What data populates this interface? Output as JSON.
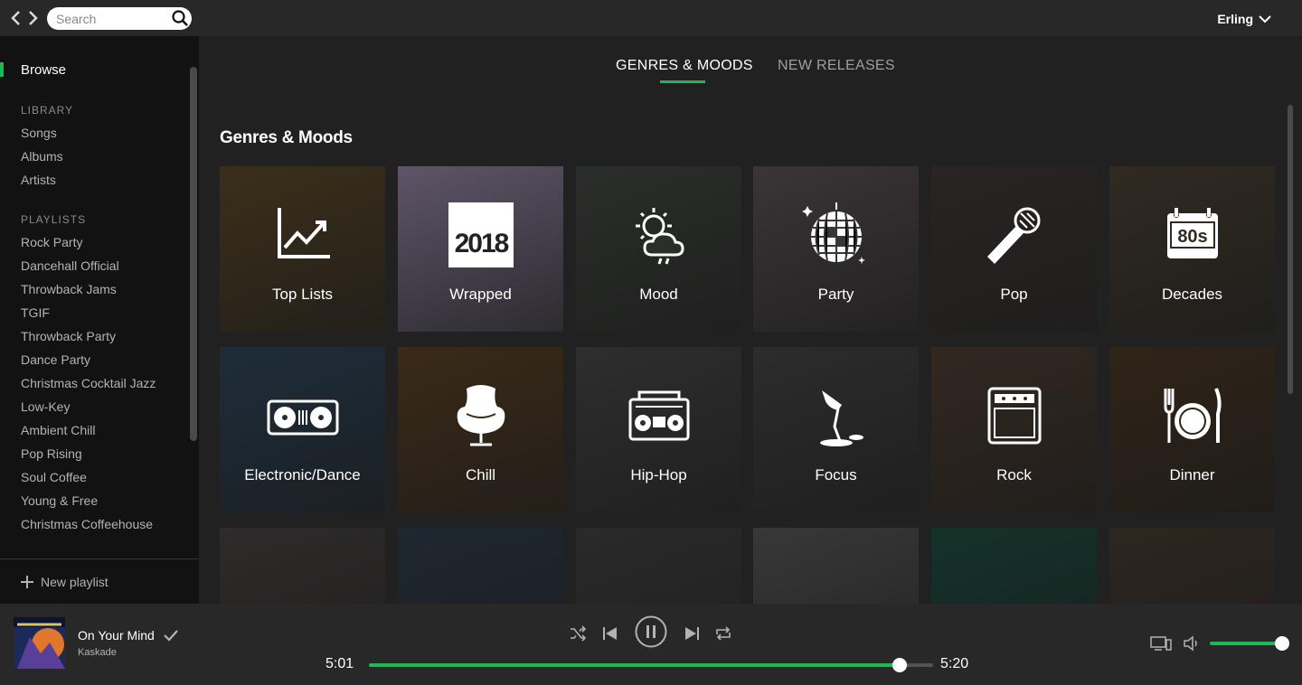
{
  "topbar": {
    "search_placeholder": "Search",
    "user_name": "Erling"
  },
  "sidebar": {
    "browse_label": "Browse",
    "library_heading": "LIBRARY",
    "library_items": [
      "Songs",
      "Albums",
      "Artists"
    ],
    "playlists_heading": "PLAYLISTS",
    "playlists": [
      "Rock Party",
      "Dancehall Official",
      "Throwback Jams",
      "TGIF",
      "Throwback Party",
      "Dance Party",
      "Christmas Cocktail Jazz",
      "Low-Key",
      "Ambient Chill",
      "Pop Rising",
      "Soul Coffee",
      "Young & Free",
      "Christmas Coffeehouse"
    ],
    "new_playlist_label": "New playlist"
  },
  "main": {
    "tabs": [
      {
        "label": "GENRES & MOODS",
        "active": true
      },
      {
        "label": "NEW RELEASES",
        "active": false
      }
    ],
    "section_title": "Genres & Moods",
    "tiles": [
      {
        "label": "Top Lists",
        "icon": "chart-up-icon",
        "bg": "#3b2f1a"
      },
      {
        "label": "Wrapped",
        "icon": "wrapped-2018-icon",
        "icon_text": "2018",
        "bg": "#5e5568"
      },
      {
        "label": "Mood",
        "icon": "sun-cloud-icon",
        "bg": "#2b2e2b"
      },
      {
        "label": "Party",
        "icon": "disco-ball-icon",
        "bg": "#3a3536"
      },
      {
        "label": "Pop",
        "icon": "microphone-icon",
        "bg": "#2a2424"
      },
      {
        "label": "Decades",
        "icon": "calendar-80s-icon",
        "icon_text": "80s",
        "bg": "#302a21"
      },
      {
        "label": "Electronic/Dance",
        "icon": "turntable-icon",
        "bg": "#1e2d3a"
      },
      {
        "label": "Chill",
        "icon": "egg-chair-icon",
        "bg": "#3a2a18"
      },
      {
        "label": "Hip-Hop",
        "icon": "boombox-icon",
        "bg": "#2e2e2e"
      },
      {
        "label": "Focus",
        "icon": "desk-lamp-icon",
        "bg": "#2c2c2c"
      },
      {
        "label": "Rock",
        "icon": "amplifier-icon",
        "bg": "#322820"
      },
      {
        "label": "Dinner",
        "icon": "plate-cutlery-icon",
        "bg": "#2f2418"
      },
      {
        "label": "",
        "icon": "",
        "bg": "#2e2b2a"
      },
      {
        "label": "",
        "icon": "",
        "bg": "#1f2730"
      },
      {
        "label": "",
        "icon": "",
        "bg": "#2a2a2a"
      },
      {
        "label": "",
        "icon": "",
        "bg": "#383838"
      },
      {
        "label": "",
        "icon": "",
        "bg": "#14322a"
      },
      {
        "label": "",
        "icon": "",
        "bg": "#2d2620"
      }
    ]
  },
  "player": {
    "track_title": "On Your Mind",
    "track_artist": "Kaskade",
    "elapsed": "5:01",
    "duration": "5:20",
    "progress_fraction": 0.941,
    "volume_fraction": 1.0,
    "accent_color": "#1db954"
  }
}
